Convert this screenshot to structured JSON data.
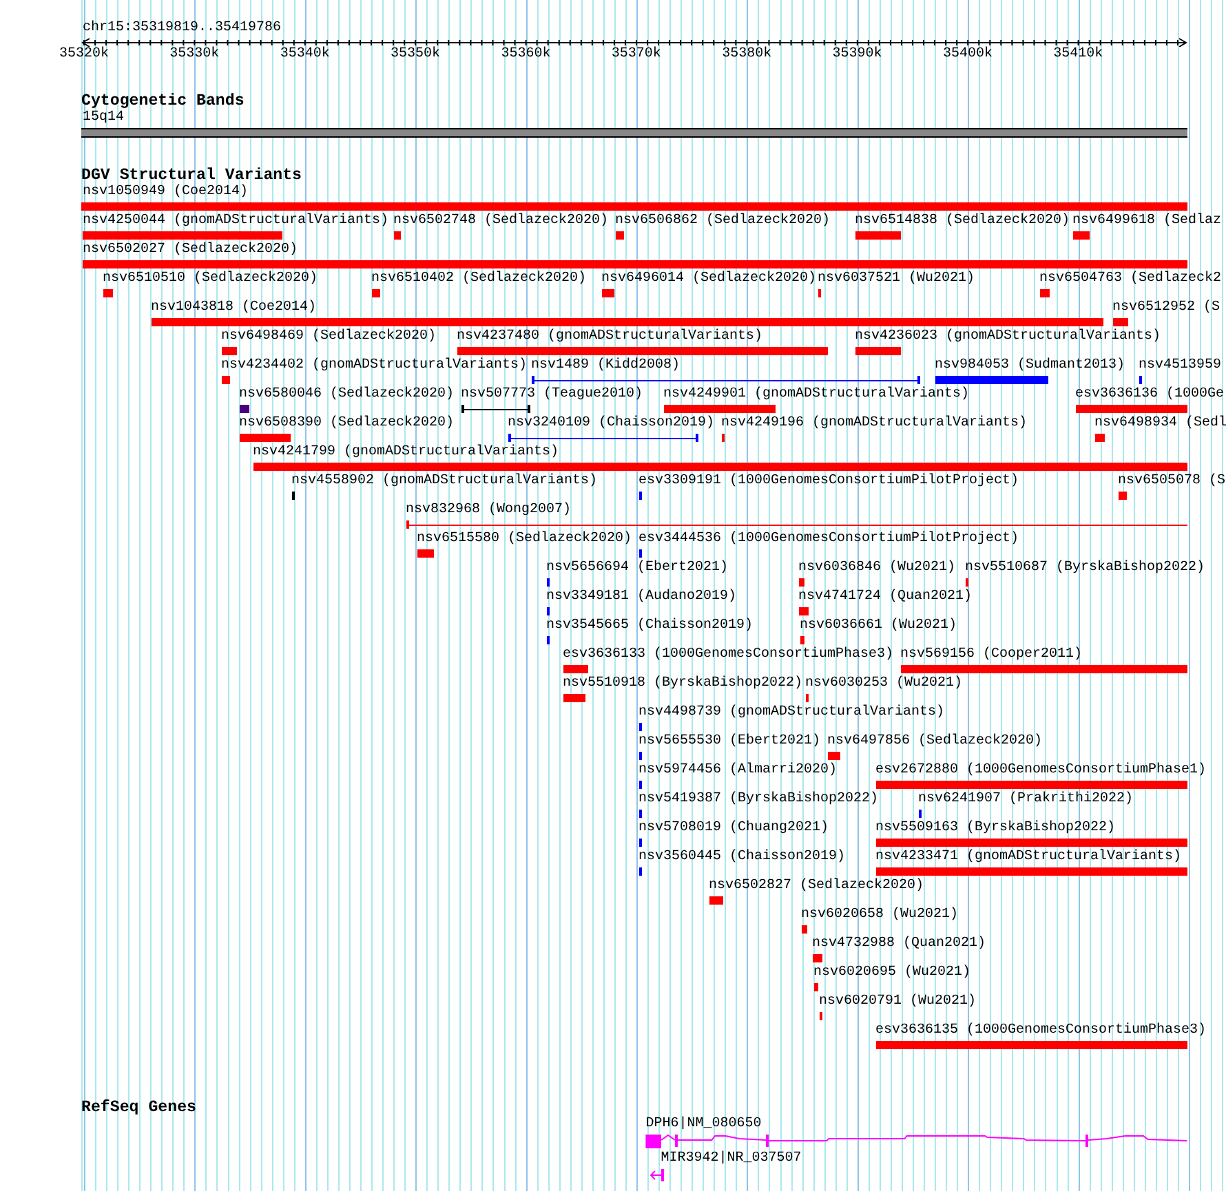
{
  "ruler": {
    "location": "chr15:35319819..35419786",
    "ticks": [
      "35320k",
      "35330k",
      "35340k",
      "35350k",
      "35360k",
      "35370k",
      "35380k",
      "35390k",
      "35400k",
      "35410k"
    ]
  },
  "tracks": [
    {
      "kind": "cytoband",
      "title": "Cytogenetic Bands",
      "band": "15q14"
    },
    {
      "kind": "variants",
      "title": "DGV Structural Variants",
      "features": [
        {
          "label": "nsv1050949 (Coe2014)",
          "kind": "bar",
          "color": "#ff0000"
        },
        {
          "label": "nsv4250044 (gnomADStructuralVariants)",
          "kind": "bar",
          "color": "#ff0000"
        },
        {
          "label": "nsv6502748 (Sedlazeck2020)",
          "kind": "bar",
          "color": "#ff0000"
        },
        {
          "label": "nsv6506862 (Sedlazeck2020)",
          "kind": "bar",
          "color": "#ff0000"
        },
        {
          "label": "nsv6514838 (Sedlazeck2020)",
          "kind": "bar",
          "color": "#ff0000"
        },
        {
          "label": "nsv6499618 (Sedlaz",
          "kind": "bar",
          "color": "#ff0000"
        },
        {
          "label": "nsv6502027 (Sedlazeck2020)",
          "kind": "bar",
          "color": "#ff0000"
        },
        {
          "label": "nsv6510510 (Sedlazeck2020)",
          "kind": "bar",
          "color": "#ff0000"
        },
        {
          "label": "nsv6510402 (Sedlazeck2020)",
          "kind": "bar",
          "color": "#ff0000"
        },
        {
          "label": "nsv6496014 (Sedlazeck2020)",
          "kind": "bar",
          "color": "#ff0000"
        },
        {
          "label": "nsv6037521 (Wu2021)",
          "kind": "bar",
          "color": "#ff0000"
        },
        {
          "label": "nsv6504763 (Sedlazeck2",
          "kind": "bar",
          "color": "#ff0000"
        },
        {
          "label": "nsv1043818 (Coe2014)",
          "kind": "bar",
          "color": "#ff0000"
        },
        {
          "label": "nsv6512952 (S",
          "kind": "bar",
          "color": "#ff0000"
        },
        {
          "label": "nsv6498469 (Sedlazeck2020)",
          "kind": "bar",
          "color": "#ff0000"
        },
        {
          "label": "nsv4237480 (gnomADStructuralVariants)",
          "kind": "bar",
          "color": "#ff0000"
        },
        {
          "label": "nsv4236023 (gnomADStructuralVariants)",
          "kind": "bar",
          "color": "#ff0000"
        },
        {
          "label": "nsv4234402 (gnomADStructuralVariants)",
          "kind": "bar",
          "color": "#ff0000"
        },
        {
          "label": "nsv1489 (Kidd2008)",
          "kind": "line",
          "color": "#0000ff"
        },
        {
          "label": "nsv984053 (Sudmant2013)",
          "kind": "bar",
          "color": "#0000ff"
        },
        {
          "label": "nsv4513959",
          "kind": "bar",
          "color": "#0000ff"
        },
        {
          "label": "nsv6580046 (Sedlazeck2020)",
          "kind": "bar",
          "color": "#4b0082"
        },
        {
          "label": "nsv507773 (Teague2010)",
          "kind": "line",
          "color": "#000000"
        },
        {
          "label": "nsv4249901 (gnomADStructuralVariants)",
          "kind": "bar",
          "color": "#ff0000"
        },
        {
          "label": "esv3636136 (1000Ge",
          "kind": "bar",
          "color": "#ff0000"
        },
        {
          "label": "nsv6508390 (Sedlazeck2020)",
          "kind": "bar",
          "color": "#ff0000"
        },
        {
          "label": "nsv3240109 (Chaisson2019)",
          "kind": "line",
          "color": "#0000ff"
        },
        {
          "label": "nsv4249196 (gnomADStructuralVariants)",
          "kind": "bar",
          "color": "#ff0000"
        },
        {
          "label": "nsv6498934 (Sedl",
          "kind": "bar",
          "color": "#ff0000"
        },
        {
          "label": "nsv4241799 (gnomADStructuralVariants)",
          "kind": "bar",
          "color": "#ff0000"
        },
        {
          "label": "nsv4558902 (gnomADStructuralVariants)",
          "kind": "bar",
          "color": "#000000"
        },
        {
          "label": "esv3309191 (1000GenomesConsortiumPilotProject)",
          "kind": "bar",
          "color": "#0000ff"
        },
        {
          "label": "nsv6505078 (S",
          "kind": "bar",
          "color": "#ff0000"
        },
        {
          "label": "nsv832968 (Wong2007)",
          "kind": "line",
          "color": "#ff0000"
        },
        {
          "label": "nsv6515580 (Sedlazeck2020)",
          "kind": "bar",
          "color": "#ff0000"
        },
        {
          "label": "esv3444536 (1000GenomesConsortiumPilotProject)",
          "kind": "bar",
          "color": "#0000ff"
        },
        {
          "label": "nsv5656694 (Ebert2021)",
          "kind": "bar",
          "color": "#0000ff"
        },
        {
          "label": "nsv6036846 (Wu2021)",
          "kind": "bar",
          "color": "#ff0000"
        },
        {
          "label": "nsv5510687 (ByrskaBishop2022)",
          "kind": "bar",
          "color": "#ff0000"
        },
        {
          "label": "nsv3349181 (Audano2019)",
          "kind": "bar",
          "color": "#0000ff"
        },
        {
          "label": "nsv4741724 (Quan2021)",
          "kind": "bar",
          "color": "#ff0000"
        },
        {
          "label": "nsv3545665 (Chaisson2019)",
          "kind": "bar",
          "color": "#0000ff"
        },
        {
          "label": "nsv6036661 (Wu2021)",
          "kind": "bar",
          "color": "#ff0000"
        },
        {
          "label": "esv3636133 (1000GenomesConsortiumPhase3)",
          "kind": "bar",
          "color": "#ff0000"
        },
        {
          "label": "nsv569156 (Cooper2011)",
          "kind": "bar",
          "color": "#ff0000"
        },
        {
          "label": "nsv5510918 (ByrskaBishop2022)",
          "kind": "bar",
          "color": "#ff0000"
        },
        {
          "label": "nsv6030253 (Wu2021)",
          "kind": "bar",
          "color": "#ff0000"
        },
        {
          "label": "nsv4498739 (gnomADStructuralVariants)",
          "kind": "bar",
          "color": "#0000ff"
        },
        {
          "label": "nsv5655530 (Ebert2021)",
          "kind": "bar",
          "color": "#0000ff"
        },
        {
          "label": "nsv6497856 (Sedlazeck2020)",
          "kind": "bar",
          "color": "#ff0000"
        },
        {
          "label": "nsv5974456 (Almarri2020)",
          "kind": "bar",
          "color": "#0000ff"
        },
        {
          "label": "esv2672880 (1000GenomesConsortiumPhase1)",
          "kind": "bar",
          "color": "#ff0000"
        },
        {
          "label": "nsv5419387 (ByrskaBishop2022)",
          "kind": "bar",
          "color": "#0000ff"
        },
        {
          "label": "nsv6241907 (Prakrithi2022)",
          "kind": "bar",
          "color": "#0000ff"
        },
        {
          "label": "nsv5708019 (Chuang2021)",
          "kind": "bar",
          "color": "#0000ff"
        },
        {
          "label": "nsv5509163 (ByrskaBishop2022)",
          "kind": "bar",
          "color": "#ff0000"
        },
        {
          "label": "nsv3560445 (Chaisson2019)",
          "kind": "bar",
          "color": "#0000ff"
        },
        {
          "label": "nsv4233471 (gnomADStructuralVariants)",
          "kind": "bar",
          "color": "#ff0000"
        },
        {
          "label": "nsv6502827 (Sedlazeck2020)",
          "kind": "bar",
          "color": "#ff0000"
        },
        {
          "label": "nsv6020658 (Wu2021)",
          "kind": "bar",
          "color": "#ff0000"
        },
        {
          "label": "nsv4732988 (Quan2021)",
          "kind": "bar",
          "color": "#ff0000"
        },
        {
          "label": "nsv6020695 (Wu2021)",
          "kind": "bar",
          "color": "#ff0000"
        },
        {
          "label": "nsv6020791 (Wu2021)",
          "kind": "bar",
          "color": "#ff0000"
        },
        {
          "label": "esv3636135 (1000GenomesConsortiumPhase3)",
          "kind": "bar",
          "color": "#ff0000"
        }
      ]
    },
    {
      "kind": "genes",
      "title": "RefSeq Genes",
      "genes": [
        {
          "label": "DPH6|NM_080650"
        },
        {
          "label": "MIR3942|NR_037507"
        }
      ]
    }
  ]
}
